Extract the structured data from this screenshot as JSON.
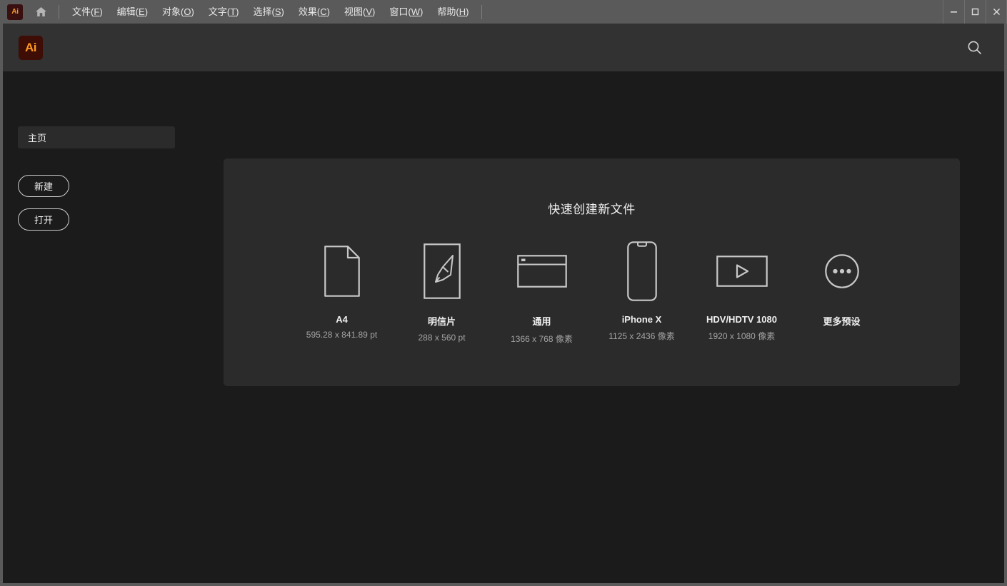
{
  "window": {
    "app_tile_label": "Ai",
    "controls": [
      {
        "name": "minimize",
        "glyph": "minimize-icon"
      },
      {
        "name": "maximize",
        "glyph": "maximize-icon"
      },
      {
        "name": "close",
        "glyph": "close-icon"
      }
    ]
  },
  "menubar": {
    "home_icon": "home-icon",
    "items": [
      {
        "label": "文件(F)",
        "text": "文件",
        "mnemonic": "F"
      },
      {
        "label": "编辑(E)",
        "text": "编辑",
        "mnemonic": "E"
      },
      {
        "label": "对象(O)",
        "text": "对象",
        "mnemonic": "O"
      },
      {
        "label": "文字(T)",
        "text": "文字",
        "mnemonic": "T"
      },
      {
        "label": "选择(S)",
        "text": "选择",
        "mnemonic": "S"
      },
      {
        "label": "效果(C)",
        "text": "效果",
        "mnemonic": "C"
      },
      {
        "label": "视图(V)",
        "text": "视图",
        "mnemonic": "V"
      },
      {
        "label": "窗口(W)",
        "text": "窗口",
        "mnemonic": "W"
      },
      {
        "label": "帮助(H)",
        "text": "帮助",
        "mnemonic": "H"
      }
    ]
  },
  "header": {
    "logo_label": "Ai",
    "search_icon": "search-icon"
  },
  "sidebar": {
    "nav": [
      {
        "label": "主页",
        "selected": true
      }
    ],
    "buttons": [
      {
        "label": "新建"
      },
      {
        "label": "打开"
      }
    ]
  },
  "quick_create": {
    "title": "快速创建新文件",
    "presets": [
      {
        "name": "A4",
        "size": "595.28 x 841.89 pt",
        "icon": "document-page-icon"
      },
      {
        "name": "明信片",
        "size": "288 x 560 pt",
        "icon": "paintbrush-icon"
      },
      {
        "name": "通用",
        "size": "1366 x 768 像素",
        "icon": "browser-window-icon"
      },
      {
        "name": "iPhone X",
        "size": "1125 x 2436 像素",
        "icon": "phone-icon"
      },
      {
        "name": "HDV/HDTV 1080",
        "size": "1920 x 1080 像素",
        "icon": "video-play-icon"
      },
      {
        "name": "更多预设",
        "size": "",
        "icon": "more-dots-icon"
      }
    ]
  },
  "colors": {
    "titlebar": "#5a5a5a",
    "header_band": "#323232",
    "app_background": "#1b1b1b",
    "panel": "#2b2b2b",
    "accent_orange": "#ff9a1f",
    "logo_maroon": "#3d0d06",
    "text_primary": "#f0f0f0",
    "text_secondary": "#a3a3a3",
    "icon_stroke": "#c8c8c8"
  }
}
